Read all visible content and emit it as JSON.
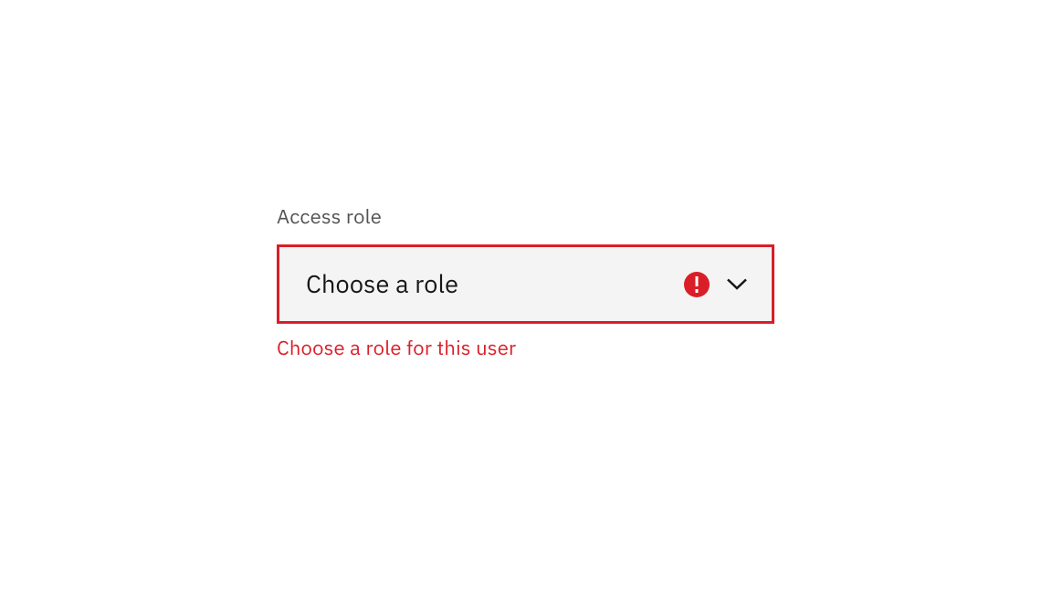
{
  "field": {
    "label": "Access role",
    "placeholder": "Choose a role",
    "error_message": "Choose a role for this user"
  },
  "colors": {
    "error": "#da1e28",
    "background": "#f4f4f4",
    "text_primary": "#161616",
    "text_secondary": "#525252"
  }
}
